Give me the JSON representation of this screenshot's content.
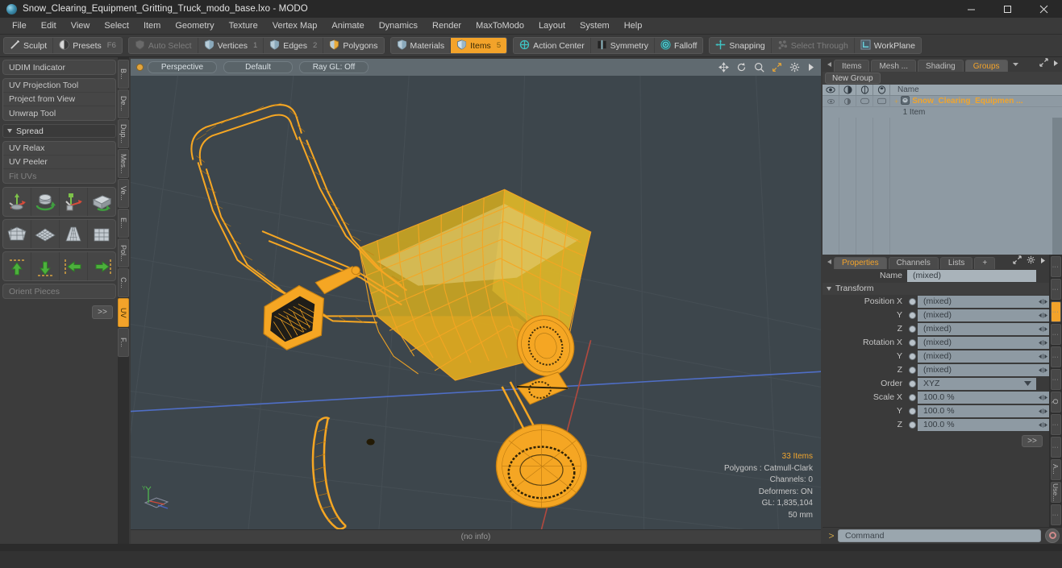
{
  "window": {
    "title": "Snow_Clearing_Equipment_Gritting_Truck_modo_base.lxo - MODO",
    "minimize": "minimize-icon",
    "maximize": "maximize-icon",
    "close": "close-icon"
  },
  "menubar": {
    "items": [
      "File",
      "Edit",
      "View",
      "Select",
      "Item",
      "Geometry",
      "Texture",
      "Vertex Map",
      "Animate",
      "Dynamics",
      "Render",
      "MaxToModo",
      "Layout",
      "System",
      "Help"
    ]
  },
  "toolbar": {
    "groups": [
      {
        "buttons": [
          {
            "label": "Sculpt",
            "icon": "sculpt-icon",
            "key": "",
            "state": "normal"
          },
          {
            "label": "Presets",
            "icon": "presets-icon",
            "key": "F6",
            "state": "normal"
          }
        ]
      },
      {
        "buttons": [
          {
            "label": "Auto Select",
            "icon": "shield-icon",
            "key": "",
            "state": "dim"
          },
          {
            "label": "Vertices",
            "icon": "vertices-icon",
            "key": "1",
            "state": "normal"
          },
          {
            "label": "Edges",
            "icon": "edges-icon",
            "key": "2",
            "state": "normal"
          },
          {
            "label": "Polygons",
            "icon": "polygons-icon",
            "key": "",
            "state": "normal"
          }
        ]
      },
      {
        "buttons": [
          {
            "label": "Materials",
            "icon": "materials-icon",
            "key": "",
            "state": "normal"
          },
          {
            "label": "Items",
            "icon": "items-icon",
            "key": "5",
            "state": "selected"
          }
        ]
      },
      {
        "buttons": [
          {
            "label": "Action Center",
            "icon": "action-center-icon",
            "key": "",
            "state": "normal"
          },
          {
            "label": "Symmetry",
            "icon": "symmetry-icon",
            "key": "",
            "state": "normal"
          },
          {
            "label": "Falloff",
            "icon": "falloff-icon",
            "key": "",
            "state": "normal"
          }
        ]
      },
      {
        "buttons": [
          {
            "label": "Snapping",
            "icon": "snapping-icon",
            "key": "",
            "state": "normal"
          },
          {
            "label": "Select Through",
            "icon": "select-through-icon",
            "key": "",
            "state": "dim"
          },
          {
            "label": "WorkPlane",
            "icon": "workplane-icon",
            "key": "",
            "state": "normal"
          }
        ]
      }
    ]
  },
  "left_panel": {
    "group1": [
      "UDIM Indicator"
    ],
    "group2": [
      "UV Projection Tool",
      "Project from View",
      "Unwrap Tool"
    ],
    "spread_header": "Spread",
    "group3": [
      {
        "label": "UV Relax",
        "state": "normal"
      },
      {
        "label": "UV Peeler",
        "state": "normal"
      },
      {
        "label": "Fit UVs",
        "state": "dim"
      }
    ],
    "icon_row_1": [
      "uv-move-icon",
      "uv-rotate-icon",
      "uv-transform-icon",
      "uv-fit-icon"
    ],
    "icon_row_2": [
      "uv-unwrap-icon",
      "uv-grid-icon",
      "uv-cone-icon",
      "uv-cube-icon"
    ],
    "icon_row_3": [
      "arrow-up-icon",
      "arrow-down-icon",
      "arrow-left-icon",
      "arrow-right-icon"
    ],
    "orient_pieces": "Orient Pieces",
    "more_button": ">>",
    "vtabs": [
      {
        "label": "B...",
        "active": false
      },
      {
        "label": "De...",
        "active": false
      },
      {
        "label": "Dup...",
        "active": false
      },
      {
        "label": "Mes...",
        "active": false
      },
      {
        "label": "Ve...",
        "active": false
      },
      {
        "label": "E...",
        "active": false
      },
      {
        "label": "Pol...",
        "active": false
      },
      {
        "label": "C...",
        "active": false
      },
      {
        "label": "UV",
        "active": true
      },
      {
        "label": "F...",
        "active": false
      }
    ]
  },
  "viewport": {
    "view_mode": "Perspective",
    "shading": "Default",
    "raygl": "Ray GL: Off",
    "tools": [
      "pan-icon",
      "rotate-icon",
      "zoom-icon",
      "fit-icon",
      "gear-icon",
      "chevron-right-icon"
    ],
    "stats": {
      "items": "33 Items",
      "polygons": "Polygons : Catmull-Clark",
      "channels": "Channels: 0",
      "deformers": "Deformers: ON",
      "gl": "GL: 1,835,104",
      "grid": "50 mm"
    },
    "status": "(no info)",
    "model_color": "#f5a623",
    "background_color": "#3d464c"
  },
  "right_panel": {
    "top_tabs": [
      {
        "label": "Items",
        "active": false
      },
      {
        "label": "Mesh ...",
        "active": false
      },
      {
        "label": "Shading",
        "active": false
      },
      {
        "label": "Groups",
        "active": true
      }
    ],
    "new_group_button": "New Group",
    "tree": {
      "columns": [
        "eye-icon",
        "render-icon",
        "wire-icon",
        "shade-icon"
      ],
      "name_header": "Name",
      "rows": [
        {
          "name": "Snow_Clearing_Equipmen ...",
          "sub": "1 Item",
          "icon": "group-icon"
        }
      ]
    },
    "props_tabs": [
      {
        "label": "Properties",
        "active": true
      },
      {
        "label": "Channels",
        "active": false
      },
      {
        "label": "Lists",
        "active": false
      },
      {
        "label": "+",
        "active": false
      }
    ],
    "name_label": "Name",
    "name_value": "(mixed)",
    "transform_header": "Transform",
    "fields": [
      {
        "label": "Position X",
        "value": "(mixed)",
        "zero": "0"
      },
      {
        "label": "Y",
        "value": "(mixed)",
        "zero": "0"
      },
      {
        "label": "Z",
        "value": "(mixed)",
        "zero": "0"
      },
      {
        "label": "Rotation X",
        "value": "(mixed)",
        "zero": "0"
      },
      {
        "label": "Y",
        "value": "(mixed)",
        "zero": "0"
      },
      {
        "label": "Z",
        "value": "(mixed)",
        "zero": "0"
      }
    ],
    "order_label": "Order",
    "order_value": "XYZ",
    "scale_fields": [
      {
        "label": "Scale X",
        "value": "100.0 %",
        "zero": "0"
      },
      {
        "label": "Y",
        "value": "100.0 %",
        "zero": "0"
      },
      {
        "label": "Z",
        "value": "100.0 %",
        "zero": "0"
      }
    ],
    "more_button": ">>",
    "vtabs": [
      {
        "label": "⋮",
        "active": false
      },
      {
        "label": "⋮",
        "active": false
      },
      {
        "label": "⋮",
        "active": true
      },
      {
        "label": "⋮",
        "active": false
      },
      {
        "label": "⋮",
        "active": false
      },
      {
        "label": "⋮",
        "active": false
      },
      {
        "label": "Q",
        "active": false
      },
      {
        "label": "⋮",
        "active": false
      },
      {
        "label": "⋮",
        "active": false
      },
      {
        "label": "A...",
        "active": false
      },
      {
        "label": "Use...",
        "active": false
      },
      {
        "label": "⋮",
        "active": false
      }
    ]
  },
  "command_bar": {
    "prompt": ">",
    "placeholder": "Command",
    "value": "Command",
    "record_icon": "record-icon"
  },
  "colors": {
    "accent": "#f3a32a",
    "panel": "#3a3a3a",
    "field": "#8e9aa3",
    "viewport_bg": "#3d464c"
  }
}
